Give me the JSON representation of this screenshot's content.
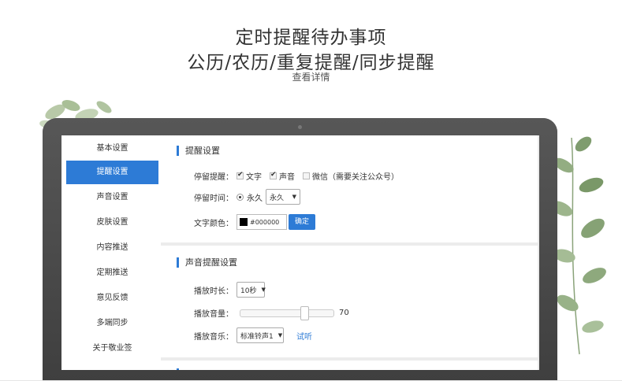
{
  "promo": {
    "line1": "定时提醒待办事项",
    "line2": "公历/农历/重复提醒/同步提醒",
    "more_link": "查看详情"
  },
  "sidebar": {
    "items": [
      {
        "label": "基本设置",
        "active": false
      },
      {
        "label": "提醒设置",
        "active": true
      },
      {
        "label": "声音设置",
        "active": false
      },
      {
        "label": "皮肤设置",
        "active": false
      },
      {
        "label": "内容推送",
        "active": false
      },
      {
        "label": "定期推送",
        "active": false
      },
      {
        "label": "意见反馈",
        "active": false
      },
      {
        "label": "多端同步",
        "active": false
      },
      {
        "label": "关于敬业签",
        "active": false
      }
    ]
  },
  "reminder_settings": {
    "title": "提醒设置",
    "stay_label": "停留提醒：",
    "options": [
      {
        "label": "文字",
        "checked": true
      },
      {
        "label": "声音",
        "checked": true
      },
      {
        "label": "微信（需要关注公众号）",
        "checked": false
      }
    ],
    "duration_label": "停留时间：",
    "duration_radio": "永久",
    "duration_select": "永久",
    "color_label": "文字颜色：",
    "color_value": "#000000",
    "confirm_button": "确定"
  },
  "sound_settings": {
    "title": "声音提醒设置",
    "length_label": "播放时长：",
    "length_value": "10秒",
    "volume_label": "播放音量：",
    "volume_value": "70",
    "volume_level": 0.7,
    "music_label": "播放音乐：",
    "music_value": "标准铃声1",
    "preview_link": "试听"
  },
  "colors": {
    "accent": "#2d7bd6",
    "laptop_body": "#4a4a4a"
  }
}
